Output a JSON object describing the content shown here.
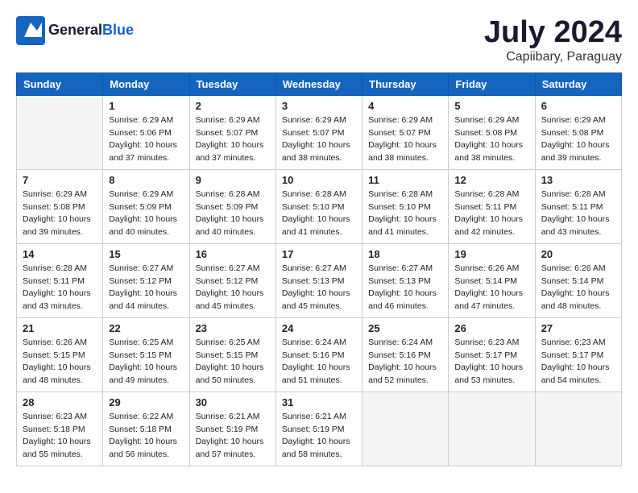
{
  "header": {
    "logo_general": "General",
    "logo_blue": "Blue",
    "month_year": "July 2024",
    "location": "Capiibary, Paraguay"
  },
  "weekdays": [
    "Sunday",
    "Monday",
    "Tuesday",
    "Wednesday",
    "Thursday",
    "Friday",
    "Saturday"
  ],
  "weeks": [
    [
      {
        "day": "",
        "info": ""
      },
      {
        "day": "1",
        "info": "Sunrise: 6:29 AM\nSunset: 5:06 PM\nDaylight: 10 hours\nand 37 minutes."
      },
      {
        "day": "2",
        "info": "Sunrise: 6:29 AM\nSunset: 5:07 PM\nDaylight: 10 hours\nand 37 minutes."
      },
      {
        "day": "3",
        "info": "Sunrise: 6:29 AM\nSunset: 5:07 PM\nDaylight: 10 hours\nand 38 minutes."
      },
      {
        "day": "4",
        "info": "Sunrise: 6:29 AM\nSunset: 5:07 PM\nDaylight: 10 hours\nand 38 minutes."
      },
      {
        "day": "5",
        "info": "Sunrise: 6:29 AM\nSunset: 5:08 PM\nDaylight: 10 hours\nand 38 minutes."
      },
      {
        "day": "6",
        "info": "Sunrise: 6:29 AM\nSunset: 5:08 PM\nDaylight: 10 hours\nand 39 minutes."
      }
    ],
    [
      {
        "day": "7",
        "info": "Sunrise: 6:29 AM\nSunset: 5:08 PM\nDaylight: 10 hours\nand 39 minutes."
      },
      {
        "day": "8",
        "info": "Sunrise: 6:29 AM\nSunset: 5:09 PM\nDaylight: 10 hours\nand 40 minutes."
      },
      {
        "day": "9",
        "info": "Sunrise: 6:28 AM\nSunset: 5:09 PM\nDaylight: 10 hours\nand 40 minutes."
      },
      {
        "day": "10",
        "info": "Sunrise: 6:28 AM\nSunset: 5:10 PM\nDaylight: 10 hours\nand 41 minutes."
      },
      {
        "day": "11",
        "info": "Sunrise: 6:28 AM\nSunset: 5:10 PM\nDaylight: 10 hours\nand 41 minutes."
      },
      {
        "day": "12",
        "info": "Sunrise: 6:28 AM\nSunset: 5:11 PM\nDaylight: 10 hours\nand 42 minutes."
      },
      {
        "day": "13",
        "info": "Sunrise: 6:28 AM\nSunset: 5:11 PM\nDaylight: 10 hours\nand 43 minutes."
      }
    ],
    [
      {
        "day": "14",
        "info": "Sunrise: 6:28 AM\nSunset: 5:11 PM\nDaylight: 10 hours\nand 43 minutes."
      },
      {
        "day": "15",
        "info": "Sunrise: 6:27 AM\nSunset: 5:12 PM\nDaylight: 10 hours\nand 44 minutes."
      },
      {
        "day": "16",
        "info": "Sunrise: 6:27 AM\nSunset: 5:12 PM\nDaylight: 10 hours\nand 45 minutes."
      },
      {
        "day": "17",
        "info": "Sunrise: 6:27 AM\nSunset: 5:13 PM\nDaylight: 10 hours\nand 45 minutes."
      },
      {
        "day": "18",
        "info": "Sunrise: 6:27 AM\nSunset: 5:13 PM\nDaylight: 10 hours\nand 46 minutes."
      },
      {
        "day": "19",
        "info": "Sunrise: 6:26 AM\nSunset: 5:14 PM\nDaylight: 10 hours\nand 47 minutes."
      },
      {
        "day": "20",
        "info": "Sunrise: 6:26 AM\nSunset: 5:14 PM\nDaylight: 10 hours\nand 48 minutes."
      }
    ],
    [
      {
        "day": "21",
        "info": "Sunrise: 6:26 AM\nSunset: 5:15 PM\nDaylight: 10 hours\nand 48 minutes."
      },
      {
        "day": "22",
        "info": "Sunrise: 6:25 AM\nSunset: 5:15 PM\nDaylight: 10 hours\nand 49 minutes."
      },
      {
        "day": "23",
        "info": "Sunrise: 6:25 AM\nSunset: 5:15 PM\nDaylight: 10 hours\nand 50 minutes."
      },
      {
        "day": "24",
        "info": "Sunrise: 6:24 AM\nSunset: 5:16 PM\nDaylight: 10 hours\nand 51 minutes."
      },
      {
        "day": "25",
        "info": "Sunrise: 6:24 AM\nSunset: 5:16 PM\nDaylight: 10 hours\nand 52 minutes."
      },
      {
        "day": "26",
        "info": "Sunrise: 6:23 AM\nSunset: 5:17 PM\nDaylight: 10 hours\nand 53 minutes."
      },
      {
        "day": "27",
        "info": "Sunrise: 6:23 AM\nSunset: 5:17 PM\nDaylight: 10 hours\nand 54 minutes."
      }
    ],
    [
      {
        "day": "28",
        "info": "Sunrise: 6:23 AM\nSunset: 5:18 PM\nDaylight: 10 hours\nand 55 minutes."
      },
      {
        "day": "29",
        "info": "Sunrise: 6:22 AM\nSunset: 5:18 PM\nDaylight: 10 hours\nand 56 minutes."
      },
      {
        "day": "30",
        "info": "Sunrise: 6:21 AM\nSunset: 5:19 PM\nDaylight: 10 hours\nand 57 minutes."
      },
      {
        "day": "31",
        "info": "Sunrise: 6:21 AM\nSunset: 5:19 PM\nDaylight: 10 hours\nand 58 minutes."
      },
      {
        "day": "",
        "info": ""
      },
      {
        "day": "",
        "info": ""
      },
      {
        "day": "",
        "info": ""
      }
    ]
  ]
}
